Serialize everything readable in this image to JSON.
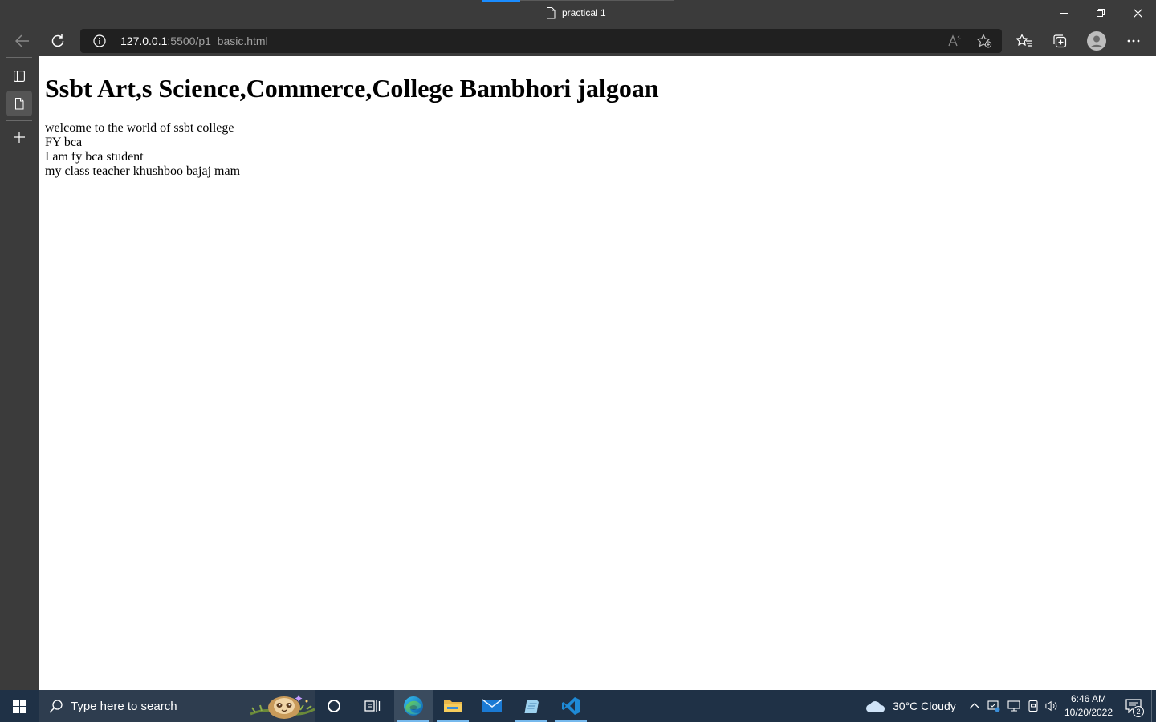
{
  "browser": {
    "tab_title": "practical 1",
    "url_host": "127.0.0.1",
    "url_path": ":5500/p1_basic.html",
    "icons": [
      "back-icon",
      "refresh-icon",
      "site-info-icon",
      "read-aloud-icon",
      "add-favorite-icon",
      "favorites-icon",
      "collections-icon",
      "profile-icon",
      "more-icon",
      "minimize-icon",
      "restore-icon",
      "close-icon"
    ]
  },
  "sidebar": {
    "icons": [
      "tab-actions-icon",
      "page-tab-icon",
      "new-tab-icon"
    ]
  },
  "page": {
    "heading": "Ssbt Art,s Science,Commerce,College Bambhori jalgoan",
    "lines": [
      "welcome to the world of ssbt college",
      "FY bca",
      "I am fy bca student",
      "my class teacher khushboo bajaj mam"
    ]
  },
  "taskbar": {
    "search_placeholder": "Type here to search",
    "weather": "30°C  Cloudy",
    "time": "6:46 AM",
    "date": "10/20/2022",
    "notification_count": "2",
    "apps": [
      "cortana",
      "task-view",
      "edge",
      "file-explorer",
      "mail",
      "notepad",
      "vscode"
    ]
  },
  "colors": {
    "chrome": "#3b3b3b",
    "address_bg": "#202020",
    "taskbar": "#1f3146",
    "accent": "#1a8cff",
    "page_bg": "#ffffff"
  }
}
